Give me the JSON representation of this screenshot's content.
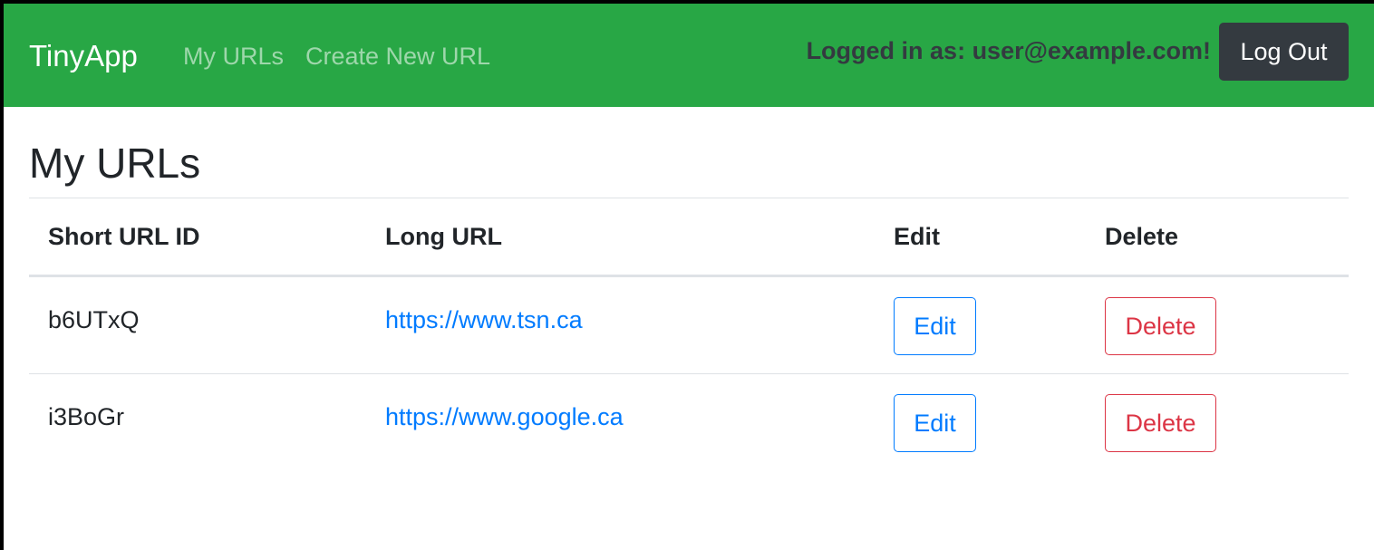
{
  "navbar": {
    "brand": "TinyApp",
    "links": [
      "My URLs",
      "Create New URL"
    ],
    "logged_in_text": "Logged in as: user@example.com!",
    "logout_label": "Log Out"
  },
  "page": {
    "title": "My URLs"
  },
  "table": {
    "headers": [
      "Short URL ID",
      "Long URL",
      "Edit",
      "Delete"
    ],
    "rows": [
      {
        "short_id": "b6UTxQ",
        "long_url": "https://www.tsn.ca",
        "edit_label": "Edit",
        "delete_label": "Delete"
      },
      {
        "short_id": "i3BoGr",
        "long_url": "https://www.google.ca",
        "edit_label": "Edit",
        "delete_label": "Delete"
      }
    ]
  },
  "colors": {
    "navbar_bg": "#28a745",
    "logout_bg": "#343a40",
    "link": "#007bff",
    "danger": "#dc3545"
  }
}
